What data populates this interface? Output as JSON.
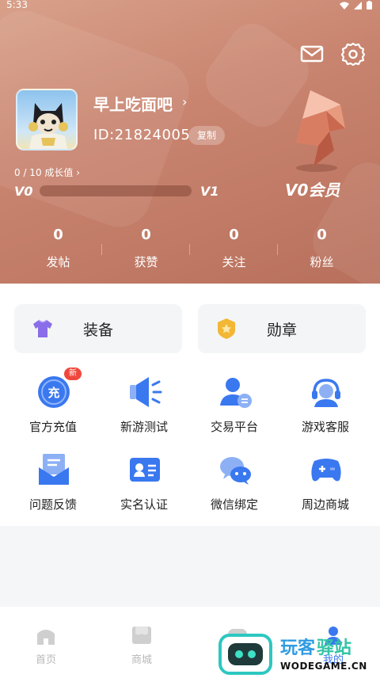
{
  "status": {
    "time": "5:33"
  },
  "profile": {
    "username": "早上吃面吧",
    "user_id": "ID:21824005",
    "copy_label": "复制",
    "growth_text": "0 / 10 成长值",
    "level_current": "V0",
    "level_next": "V1",
    "progress": 0,
    "vip_label": "V0会员"
  },
  "stats": [
    {
      "value": "0",
      "label": "发帖"
    },
    {
      "value": "0",
      "label": "获赞"
    },
    {
      "value": "0",
      "label": "关注"
    },
    {
      "value": "0",
      "label": "粉丝"
    }
  ],
  "features": [
    {
      "label": "装备",
      "icon": "tshirt-icon"
    },
    {
      "label": "勋章",
      "icon": "medal-icon"
    }
  ],
  "grid": [
    {
      "label": "官方充值",
      "icon": "recharge-icon",
      "badge": "新"
    },
    {
      "label": "新游测试",
      "icon": "megaphone-icon"
    },
    {
      "label": "交易平台",
      "icon": "trade-user-icon"
    },
    {
      "label": "游戏客服",
      "icon": "headset-icon"
    },
    {
      "label": "问题反馈",
      "icon": "feedback-envelope-icon"
    },
    {
      "label": "实名认证",
      "icon": "id-card-icon"
    },
    {
      "label": "微信绑定",
      "icon": "wechat-icon"
    },
    {
      "label": "周边商城",
      "icon": "gamepad-icon"
    }
  ],
  "bottom_nav": [
    {
      "label": "首页",
      "icon": "home-icon"
    },
    {
      "label": "商城",
      "icon": "store-icon"
    },
    {
      "label": "游戏",
      "icon": "game-icon"
    },
    {
      "label": "我的",
      "icon": "profile-icon"
    }
  ],
  "watermark": {
    "title_a": "玩客",
    "title_b": "驿站",
    "url": "WODEGAME.CN"
  },
  "colors": {
    "header": "#c98570",
    "accent_blue": "#3a78f0",
    "badge_red": "#f0473d"
  }
}
